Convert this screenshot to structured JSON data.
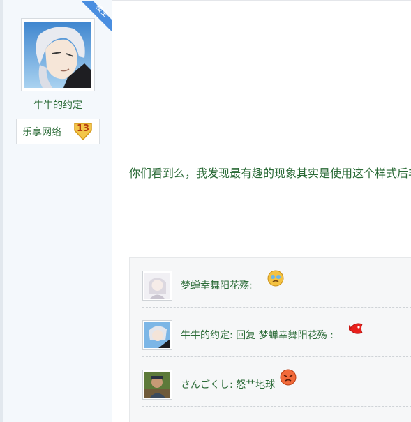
{
  "poster": {
    "name": "牛牛的约定",
    "ribbon_label": "楼主",
    "group": "乐享网络",
    "level": "13"
  },
  "post": {
    "content": "你们看到么，我发现最有趣的现象其实是使用这个样式后非"
  },
  "replies": [
    {
      "text": "梦蝉幸舞阳花殇:",
      "emoji": "crying-face-icon"
    },
    {
      "text": "牛牛的约定: 回复 梦蝉幸舞阳花殇 :",
      "emoji": "red-fish-icon"
    },
    {
      "text": "さんごくし: 怒艹地球",
      "emoji": "angry-face-icon"
    }
  ],
  "colors": {
    "text_green": "#2a6a36",
    "ribbon_blue": "#4a8ee0",
    "sidebar_bg": "#f4f8fc",
    "reply_bg": "#f6f7f8"
  }
}
